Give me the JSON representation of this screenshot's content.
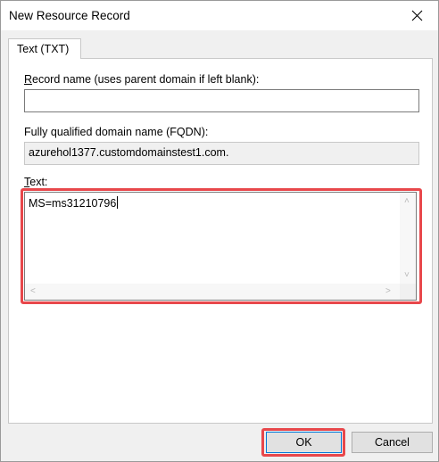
{
  "window": {
    "title": "New Resource Record"
  },
  "tabs": [
    {
      "label": "Text (TXT)"
    }
  ],
  "record_name": {
    "label_prefix": "",
    "label_accel": "R",
    "label_rest": "ecord name (uses parent domain if left blank):",
    "value": ""
  },
  "fqdn": {
    "label": "Fully qualified domain name (FQDN):",
    "value": "azurehol1377.customdomainstest1.com."
  },
  "text_field": {
    "label_accel": "T",
    "label_rest": "ext:",
    "value": "MS=ms31210796"
  },
  "buttons": {
    "ok": "OK",
    "cancel": "Cancel"
  },
  "colors": {
    "highlight": "#e8474b",
    "focus_border": "#0078d7"
  }
}
